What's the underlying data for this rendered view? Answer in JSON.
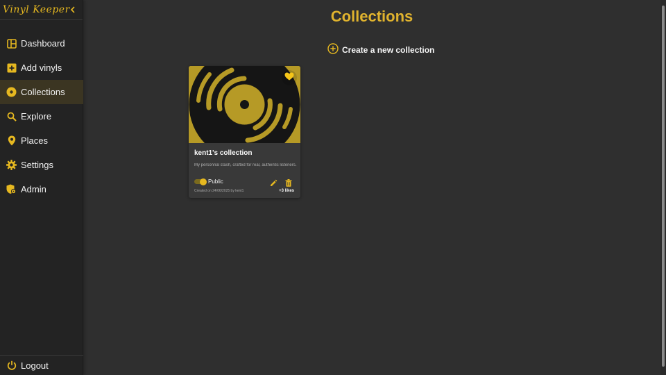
{
  "app": {
    "brand": "Vinyl Keeper",
    "collapse_icon": "chevron-left-icon",
    "accent_color": "#e0b32e"
  },
  "sidebar": {
    "items": [
      {
        "label": "Dashboard",
        "icon": "dashboard-icon",
        "active": false
      },
      {
        "label": "Add vinyls",
        "icon": "add-box-icon",
        "active": false
      },
      {
        "label": "Collections",
        "icon": "vinyl-disc-icon",
        "active": true
      },
      {
        "label": "Explore",
        "icon": "search-icon",
        "active": false
      },
      {
        "label": "Places",
        "icon": "map-pin-icon",
        "active": false
      },
      {
        "label": "Settings",
        "icon": "gear-icon",
        "active": false
      },
      {
        "label": "Admin",
        "icon": "admin-shield-icon",
        "active": false
      }
    ],
    "logout": {
      "label": "Logout",
      "icon": "power-icon"
    }
  },
  "main": {
    "title": "Collections",
    "create_label": "Create a new collection"
  },
  "collections": [
    {
      "title": "kent1's collection",
      "description": "My personnal stash, crafted for real, authentic listeners...",
      "visibility": "Public",
      "public": true,
      "favorite": true,
      "created": "Created on 24/06/2025 by kent1",
      "likes": "+3 likes"
    }
  ]
}
